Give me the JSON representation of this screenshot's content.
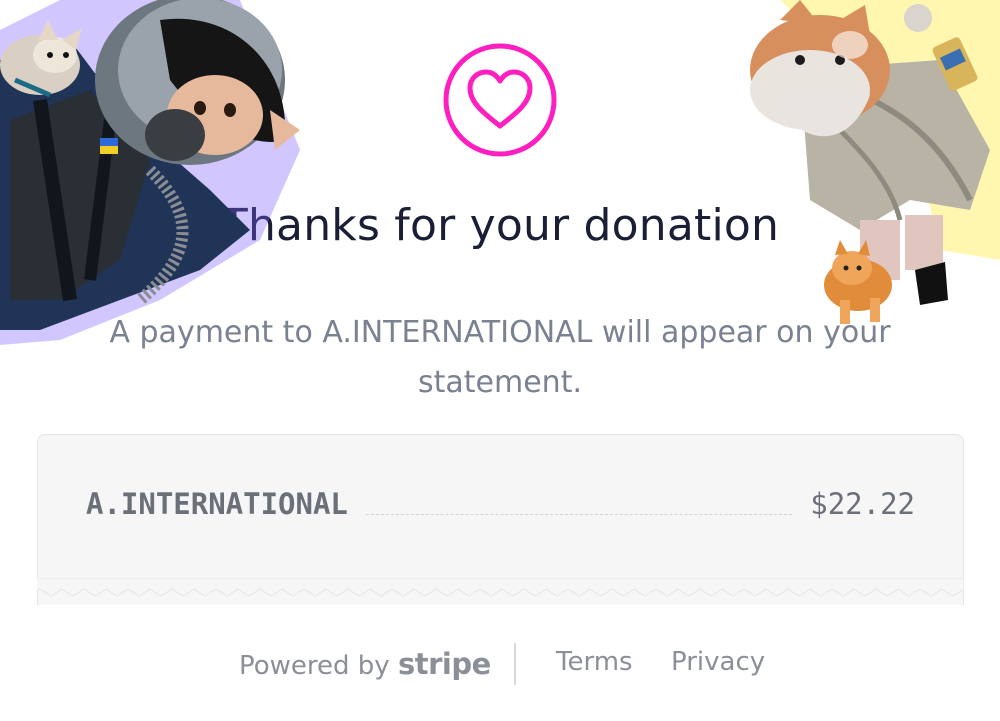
{
  "colors": {
    "accent": "#ff1fc0",
    "title_text": "#1a1f36",
    "muted_text": "#7a8190",
    "receipt_bg": "#f6f6f6"
  },
  "header": {
    "icon": "heart-icon",
    "title": "Thanks for your donation",
    "subtitle": "A payment to A.INTERNATIONAL will appear on your statement."
  },
  "receipt": {
    "merchant": "A.INTERNATIONAL",
    "amount": "$22.22"
  },
  "footer": {
    "powered_by_prefix": "Powered by",
    "powered_by_brand": "stripe",
    "links": [
      {
        "label": "Terms"
      },
      {
        "label": "Privacy"
      }
    ]
  },
  "stickers": {
    "left": "pilot-cat-sticker",
    "right": "robed-cat-sticker"
  }
}
